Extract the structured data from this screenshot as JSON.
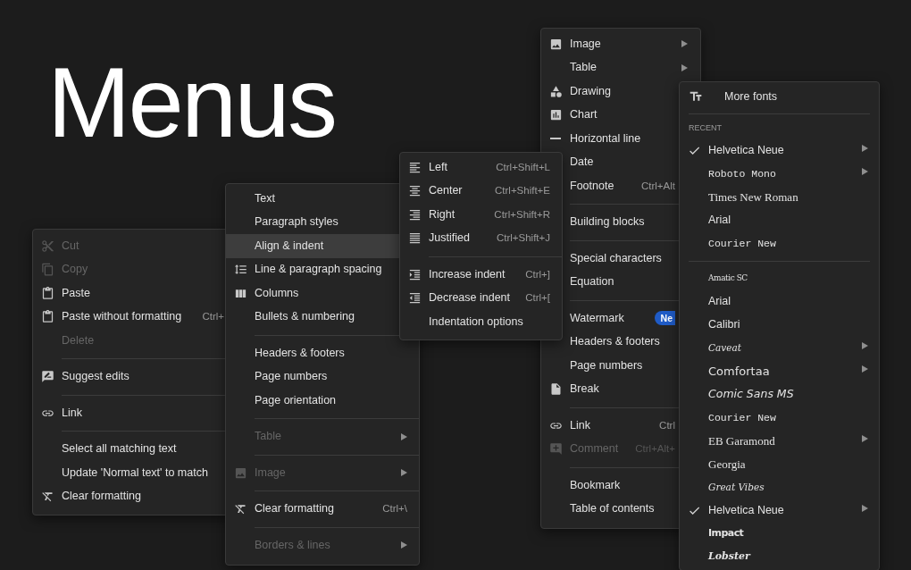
{
  "title": "Menus",
  "context_menu": {
    "groups": [
      [
        {
          "label": "Cut",
          "disabled": true
        },
        {
          "label": "Copy",
          "disabled": true
        },
        {
          "label": "Paste",
          "disabled": false
        },
        {
          "label": "Paste without formatting",
          "shortcut": "Ctrl+",
          "disabled": false
        },
        {
          "label": "Delete",
          "disabled": true
        }
      ],
      [
        {
          "label": "Suggest edits",
          "disabled": false
        }
      ],
      [
        {
          "label": "Link",
          "disabled": false
        }
      ],
      [
        {
          "label": "Select all matching text",
          "disabled": false
        },
        {
          "label": "Update 'Normal text' to match",
          "disabled": false
        },
        {
          "label": "Clear formatting",
          "disabled": false
        }
      ]
    ]
  },
  "format_menu": {
    "groups": [
      [
        {
          "label": "Text",
          "selected": false,
          "disabled": false
        },
        {
          "label": "Paragraph styles",
          "selected": false,
          "disabled": false
        },
        {
          "label": "Align & indent",
          "selected": true,
          "disabled": false
        },
        {
          "label": "Line & paragraph spacing",
          "selected": false,
          "disabled": false
        },
        {
          "label": "Columns",
          "selected": false,
          "disabled": false
        },
        {
          "label": "Bullets & numbering",
          "selected": false,
          "disabled": false
        }
      ],
      [
        {
          "label": "Headers & footers",
          "selected": false,
          "disabled": false,
          "submenu": false
        },
        {
          "label": "Page numbers",
          "selected": false,
          "disabled": false,
          "submenu": false
        },
        {
          "label": "Page orientation",
          "selected": false,
          "disabled": false,
          "submenu": false
        }
      ],
      [
        {
          "label": "Table",
          "selected": false,
          "disabled": true,
          "submenu": true
        }
      ],
      [
        {
          "label": "Image",
          "selected": false,
          "disabled": true,
          "submenu": true
        }
      ],
      [
        {
          "label": "Clear formatting",
          "shortcut": "Ctrl+\\",
          "selected": false,
          "disabled": false,
          "submenu": false
        }
      ],
      [
        {
          "label": "Borders & lines",
          "selected": false,
          "disabled": true,
          "submenu": true
        }
      ]
    ]
  },
  "align_menu": {
    "groups": [
      [
        {
          "label": "Left",
          "shortcut": "Ctrl+Shift+L"
        },
        {
          "label": "Center",
          "shortcut": "Ctrl+Shift+E"
        },
        {
          "label": "Right",
          "shortcut": "Ctrl+Shift+R"
        },
        {
          "label": "Justified",
          "shortcut": "Ctrl+Shift+J"
        }
      ],
      [
        {
          "label": "Increase indent",
          "shortcut": "Ctrl+]"
        },
        {
          "label": "Decrease indent",
          "shortcut": "Ctrl+["
        },
        {
          "label": "Indentation options"
        }
      ]
    ]
  },
  "insert_menu": {
    "groups": [
      [
        {
          "label": "Image",
          "disabled": false,
          "submenu": true
        },
        {
          "label": "Table",
          "disabled": false,
          "submenu": true
        },
        {
          "label": "Drawing",
          "disabled": false
        },
        {
          "label": "Chart",
          "disabled": false
        },
        {
          "label": "Horizontal line",
          "disabled": false
        },
        {
          "label": "Date",
          "disabled": false
        },
        {
          "label": "Footnote",
          "shortcut": "Ctrl+Alt",
          "disabled": false
        }
      ],
      [
        {
          "label": "Building blocks",
          "disabled": false
        }
      ],
      [
        {
          "label": "Special characters",
          "disabled": false
        },
        {
          "label": "Equation",
          "disabled": false
        }
      ],
      [
        {
          "label": "Watermark",
          "badge": "Ne",
          "disabled": false
        },
        {
          "label": "Headers & footers",
          "disabled": false
        },
        {
          "label": "Page numbers",
          "disabled": false
        },
        {
          "label": "Break",
          "disabled": false
        }
      ],
      [
        {
          "label": "Link",
          "shortcut": "Ctrl",
          "disabled": false
        },
        {
          "label": "Comment",
          "shortcut": "Ctrl+Alt+",
          "disabled": true
        }
      ],
      [
        {
          "label": "Bookmark",
          "disabled": false
        },
        {
          "label": "Table of contents",
          "disabled": false
        }
      ]
    ]
  },
  "font_menu": {
    "more_fonts": "More fonts",
    "section_label": "RECENT",
    "groups": [
      [
        {
          "label": "Helvetica Neue",
          "kind": "sans",
          "checked": true,
          "submenu": true
        },
        {
          "label": "Roboto Mono",
          "kind": "mono",
          "checked": false,
          "submenu": true
        },
        {
          "label": "Times New Roman",
          "kind": "serif",
          "checked": false,
          "submenu": false
        },
        {
          "label": "Arial",
          "kind": "sans",
          "checked": false,
          "submenu": false
        },
        {
          "label": "Courier New",
          "kind": "mono",
          "checked": false,
          "submenu": false
        }
      ],
      [
        {
          "label": "Amatic SC",
          "kind": "condensed",
          "checked": false,
          "submenu": false
        },
        {
          "label": "Arial",
          "kind": "sans",
          "checked": false,
          "submenu": false
        },
        {
          "label": "Calibri",
          "kind": "sans",
          "checked": false,
          "submenu": false
        },
        {
          "label": "Caveat",
          "kind": "script",
          "checked": false,
          "submenu": true
        },
        {
          "label": "Comfortaa",
          "kind": "rounded",
          "checked": false,
          "submenu": true
        },
        {
          "label": "Comic Sans MS",
          "kind": "casual",
          "checked": false,
          "submenu": false
        },
        {
          "label": "Courier New",
          "kind": "mono",
          "checked": false,
          "submenu": false
        },
        {
          "label": "EB Garamond",
          "kind": "serif",
          "checked": false,
          "submenu": true
        },
        {
          "label": "Georgia",
          "kind": "serif",
          "checked": false,
          "submenu": false
        },
        {
          "label": "Great Vibes",
          "kind": "script",
          "checked": false,
          "submenu": false
        },
        {
          "label": "Helvetica Neue",
          "kind": "sans",
          "checked": true,
          "submenu": true
        },
        {
          "label": "Impact",
          "kind": "heavy",
          "checked": false,
          "submenu": false
        },
        {
          "label": "Lobster",
          "kind": "bold-script",
          "checked": false,
          "submenu": false
        }
      ]
    ]
  }
}
